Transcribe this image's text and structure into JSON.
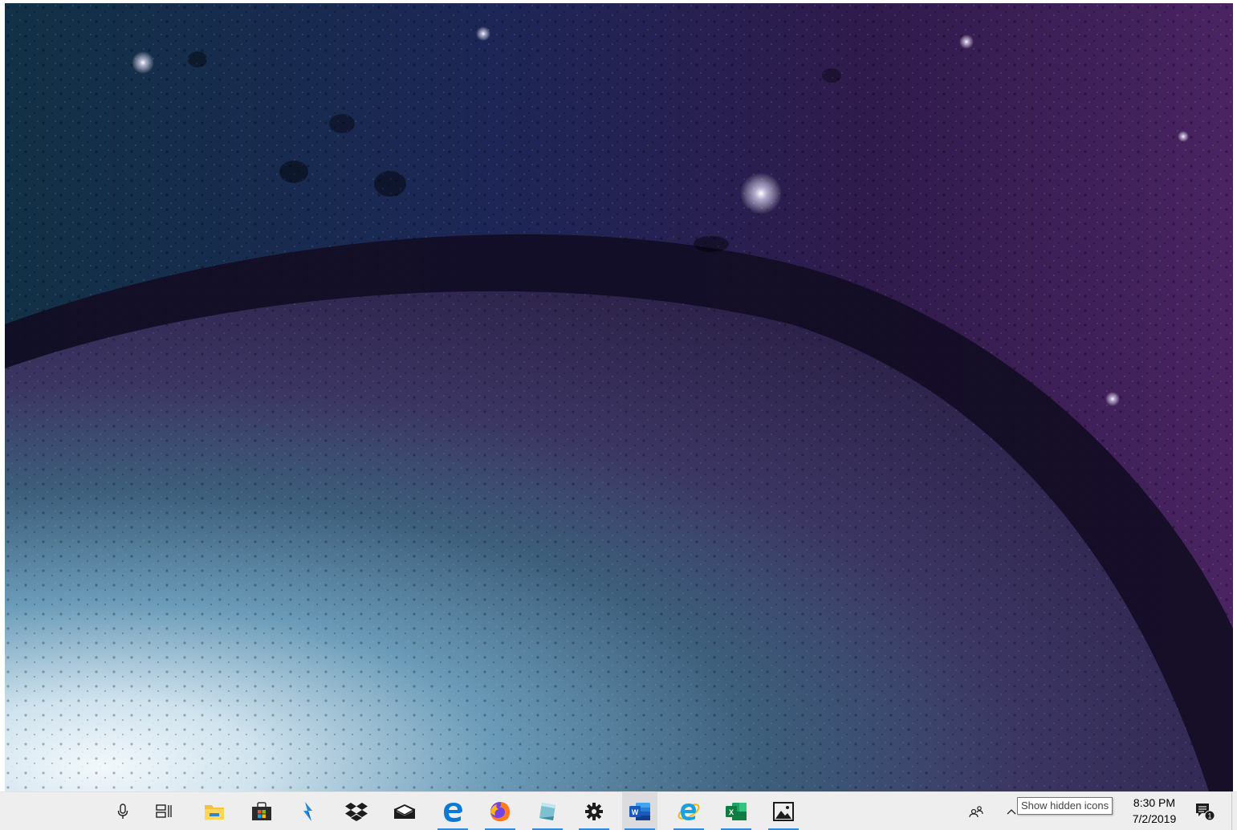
{
  "desktop": {
    "wallpaper_description_icon": "planet-wallpaper"
  },
  "taskbar": {
    "accent_color": "#2f8ae0",
    "pinned": [
      {
        "name": "cortana-mic",
        "icon": "microphone-icon",
        "running": false
      },
      {
        "name": "task-view",
        "icon": "task-view-icon",
        "running": false
      },
      {
        "name": "file-explorer",
        "icon": "folder-icon",
        "running": false
      },
      {
        "name": "microsoft-store",
        "icon": "store-bag-icon",
        "running": false
      },
      {
        "name": "power-automate",
        "icon": "lightning-icon",
        "running": false
      },
      {
        "name": "dropbox",
        "icon": "dropbox-icon",
        "running": false
      },
      {
        "name": "mail",
        "icon": "mail-envelope-icon",
        "running": false
      },
      {
        "name": "edge",
        "icon": "edge-icon",
        "running": true
      },
      {
        "name": "firefox",
        "icon": "firefox-icon",
        "running": true
      },
      {
        "name": "notepad-like",
        "icon": "note-icon",
        "running": true
      },
      {
        "name": "settings",
        "icon": "gear-icon",
        "running": true
      },
      {
        "name": "word",
        "icon": "word-icon",
        "running": true
      },
      {
        "name": "internet-explorer",
        "icon": "ie-icon",
        "running": true
      },
      {
        "name": "excel",
        "icon": "excel-icon",
        "running": true
      },
      {
        "name": "photos",
        "icon": "photos-icon",
        "running": true
      }
    ]
  },
  "tray": {
    "people_icon": "people-icon",
    "chevron_icon": "chevron-up-icon",
    "tooltip": "Show hidden icons",
    "time": "8:30 PM",
    "date": "7/2/2019",
    "notification_count": "1"
  }
}
